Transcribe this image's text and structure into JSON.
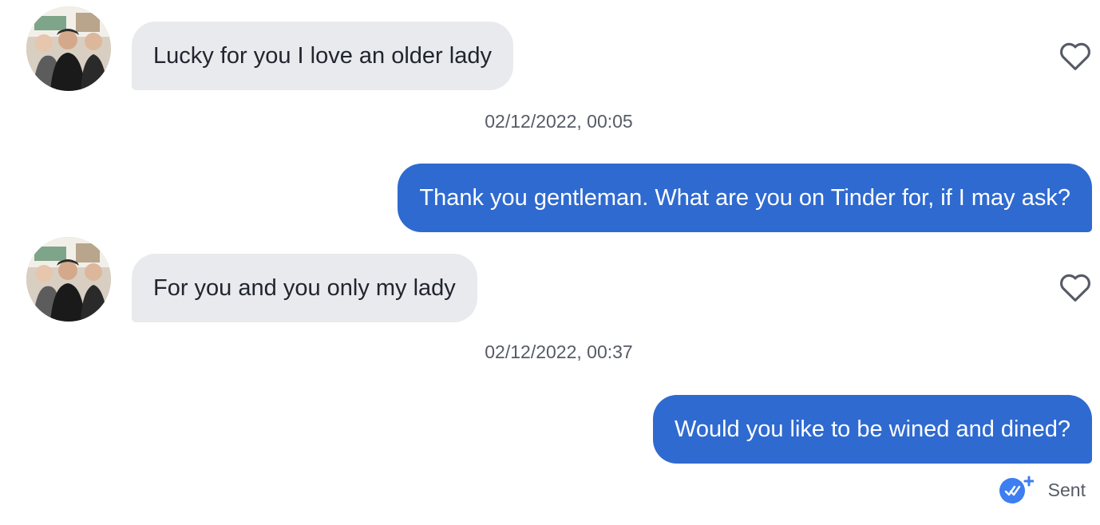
{
  "messages": [
    {
      "sender": "them",
      "text": "Lucky for you I love an older lady"
    },
    {
      "timestamp": "02/12/2022, 00:05"
    },
    {
      "sender": "me",
      "text": "Thank you gentleman. What are you on Tinder for, if I may ask?"
    },
    {
      "sender": "them",
      "text": "For you and you only my lady"
    },
    {
      "timestamp": "02/12/2022, 00:37"
    },
    {
      "sender": "me",
      "text": "Would you like to be wined and dined?"
    }
  ],
  "status": {
    "label": "Sent",
    "icon": "double-check-boost-icon"
  },
  "colors": {
    "incoming_bubble": "#e9eaee",
    "outgoing_bubble": "#2f6ad0",
    "status_icon": "#3d7ef0",
    "heart_outline": "#565b66"
  }
}
